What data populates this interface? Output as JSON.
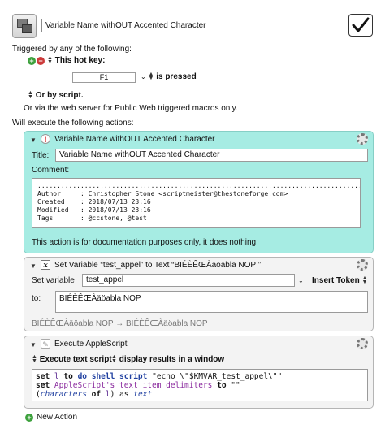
{
  "header": {
    "macro_name": "Variable Name withOUT Accented Character"
  },
  "triggers": {
    "triggered_by": "Triggered by any of the following:",
    "hot_key_label": "This hot key:",
    "hot_key_value": "F1",
    "hot_key_state": "is pressed",
    "or_by_script": "Or by script.",
    "web_server": "Or via the web server for Public Web triggered macros only."
  },
  "will_execute": "Will execute the following actions:",
  "comment_action": {
    "title_bar": "Variable Name withOUT Accented Character",
    "title_label": "Title:",
    "title_value": "Variable Name withOUT Accented Character",
    "comment_label": "Comment:",
    "dots": "..............................................................................................",
    "lines": [
      "Author     : Christopher Stone <scriptmeister@thestoneforge.com>",
      "Created    : 2018/07/13 23:16",
      "Modified   : 2018/07/13 23:16",
      "Tags       : @ccstone, @test"
    ],
    "footer": "This action is for documentation purposes only, it does nothing."
  },
  "setvar_action": {
    "title_bar": "Set Variable “test_appel” to Text “BIÉÈÊŒÀäöabla NOP ”",
    "set_variable_label": "Set variable",
    "variable_name": "test_appel",
    "insert_token": "Insert Token",
    "to_label": "to:",
    "to_value": "BIÉÈÊŒÀäöabla NOP",
    "preview_from": "BIÉÈÊŒÀäöabla NOP",
    "preview_arrow": "→",
    "preview_to": "BIÉÈÊŒÀäöabla NOP"
  },
  "applescript_action": {
    "title_bar": "Execute AppleScript",
    "mode": "Execute text script",
    "display": "display results in a window",
    "code": {
      "l1_set": "set",
      "l1_l": "l",
      "l1_to": "to",
      "l1_do": "do shell script",
      "l1_str": "\"echo \\\"$KMVAR_test_appel\\\"\"",
      "l2_set": "set",
      "l2_prop": "AppleScript's text item delimiters",
      "l2_to": "to",
      "l2_str": "\"\"",
      "l3_open": "(",
      "l3_chars": "characters",
      "l3_of": "of",
      "l3_l": "l",
      "l3_close": ") as",
      "l3_text": "text"
    }
  },
  "new_action": "New Action",
  "colors": {
    "comment_bg": "#a6ece3",
    "add_green": "#3da13d",
    "remove_red": "#cc3a3a"
  }
}
